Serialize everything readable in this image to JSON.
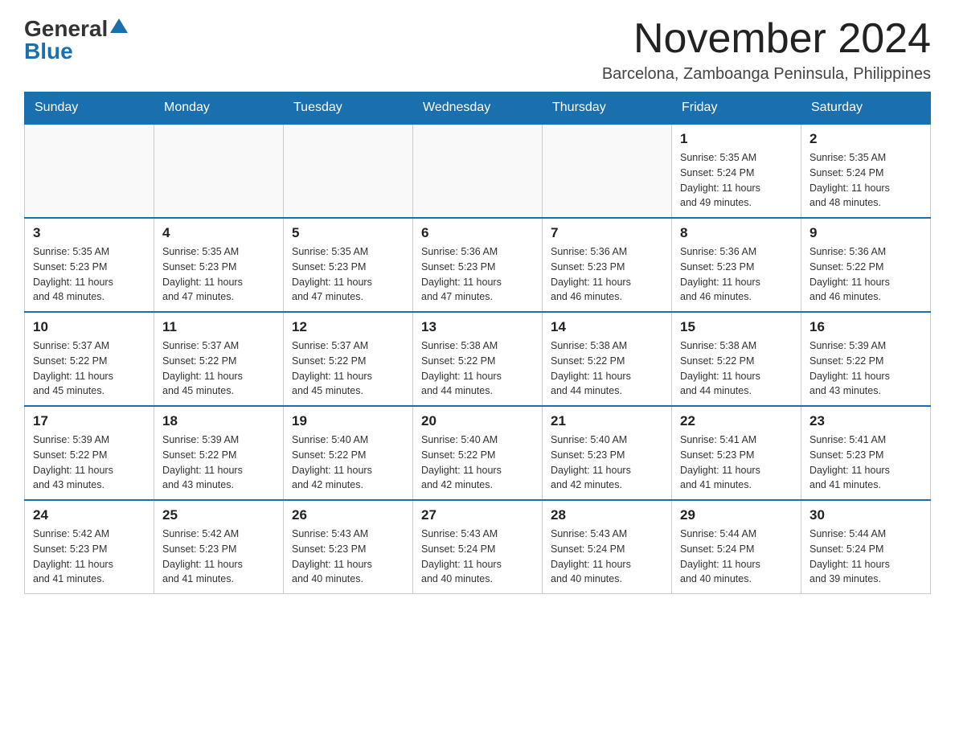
{
  "logo": {
    "text_general": "General",
    "text_blue": "Blue",
    "alt": "GeneralBlue Logo"
  },
  "title": "November 2024",
  "subtitle": "Barcelona, Zamboanga Peninsula, Philippines",
  "days_of_week": [
    "Sunday",
    "Monday",
    "Tuesday",
    "Wednesday",
    "Thursday",
    "Friday",
    "Saturday"
  ],
  "weeks": [
    [
      {
        "day": "",
        "info": ""
      },
      {
        "day": "",
        "info": ""
      },
      {
        "day": "",
        "info": ""
      },
      {
        "day": "",
        "info": ""
      },
      {
        "day": "",
        "info": ""
      },
      {
        "day": "1",
        "info": "Sunrise: 5:35 AM\nSunset: 5:24 PM\nDaylight: 11 hours\nand 49 minutes."
      },
      {
        "day": "2",
        "info": "Sunrise: 5:35 AM\nSunset: 5:24 PM\nDaylight: 11 hours\nand 48 minutes."
      }
    ],
    [
      {
        "day": "3",
        "info": "Sunrise: 5:35 AM\nSunset: 5:23 PM\nDaylight: 11 hours\nand 48 minutes."
      },
      {
        "day": "4",
        "info": "Sunrise: 5:35 AM\nSunset: 5:23 PM\nDaylight: 11 hours\nand 47 minutes."
      },
      {
        "day": "5",
        "info": "Sunrise: 5:35 AM\nSunset: 5:23 PM\nDaylight: 11 hours\nand 47 minutes."
      },
      {
        "day": "6",
        "info": "Sunrise: 5:36 AM\nSunset: 5:23 PM\nDaylight: 11 hours\nand 47 minutes."
      },
      {
        "day": "7",
        "info": "Sunrise: 5:36 AM\nSunset: 5:23 PM\nDaylight: 11 hours\nand 46 minutes."
      },
      {
        "day": "8",
        "info": "Sunrise: 5:36 AM\nSunset: 5:23 PM\nDaylight: 11 hours\nand 46 minutes."
      },
      {
        "day": "9",
        "info": "Sunrise: 5:36 AM\nSunset: 5:22 PM\nDaylight: 11 hours\nand 46 minutes."
      }
    ],
    [
      {
        "day": "10",
        "info": "Sunrise: 5:37 AM\nSunset: 5:22 PM\nDaylight: 11 hours\nand 45 minutes."
      },
      {
        "day": "11",
        "info": "Sunrise: 5:37 AM\nSunset: 5:22 PM\nDaylight: 11 hours\nand 45 minutes."
      },
      {
        "day": "12",
        "info": "Sunrise: 5:37 AM\nSunset: 5:22 PM\nDaylight: 11 hours\nand 45 minutes."
      },
      {
        "day": "13",
        "info": "Sunrise: 5:38 AM\nSunset: 5:22 PM\nDaylight: 11 hours\nand 44 minutes."
      },
      {
        "day": "14",
        "info": "Sunrise: 5:38 AM\nSunset: 5:22 PM\nDaylight: 11 hours\nand 44 minutes."
      },
      {
        "day": "15",
        "info": "Sunrise: 5:38 AM\nSunset: 5:22 PM\nDaylight: 11 hours\nand 44 minutes."
      },
      {
        "day": "16",
        "info": "Sunrise: 5:39 AM\nSunset: 5:22 PM\nDaylight: 11 hours\nand 43 minutes."
      }
    ],
    [
      {
        "day": "17",
        "info": "Sunrise: 5:39 AM\nSunset: 5:22 PM\nDaylight: 11 hours\nand 43 minutes."
      },
      {
        "day": "18",
        "info": "Sunrise: 5:39 AM\nSunset: 5:22 PM\nDaylight: 11 hours\nand 43 minutes."
      },
      {
        "day": "19",
        "info": "Sunrise: 5:40 AM\nSunset: 5:22 PM\nDaylight: 11 hours\nand 42 minutes."
      },
      {
        "day": "20",
        "info": "Sunrise: 5:40 AM\nSunset: 5:22 PM\nDaylight: 11 hours\nand 42 minutes."
      },
      {
        "day": "21",
        "info": "Sunrise: 5:40 AM\nSunset: 5:23 PM\nDaylight: 11 hours\nand 42 minutes."
      },
      {
        "day": "22",
        "info": "Sunrise: 5:41 AM\nSunset: 5:23 PM\nDaylight: 11 hours\nand 41 minutes."
      },
      {
        "day": "23",
        "info": "Sunrise: 5:41 AM\nSunset: 5:23 PM\nDaylight: 11 hours\nand 41 minutes."
      }
    ],
    [
      {
        "day": "24",
        "info": "Sunrise: 5:42 AM\nSunset: 5:23 PM\nDaylight: 11 hours\nand 41 minutes."
      },
      {
        "day": "25",
        "info": "Sunrise: 5:42 AM\nSunset: 5:23 PM\nDaylight: 11 hours\nand 41 minutes."
      },
      {
        "day": "26",
        "info": "Sunrise: 5:43 AM\nSunset: 5:23 PM\nDaylight: 11 hours\nand 40 minutes."
      },
      {
        "day": "27",
        "info": "Sunrise: 5:43 AM\nSunset: 5:24 PM\nDaylight: 11 hours\nand 40 minutes."
      },
      {
        "day": "28",
        "info": "Sunrise: 5:43 AM\nSunset: 5:24 PM\nDaylight: 11 hours\nand 40 minutes."
      },
      {
        "day": "29",
        "info": "Sunrise: 5:44 AM\nSunset: 5:24 PM\nDaylight: 11 hours\nand 40 minutes."
      },
      {
        "day": "30",
        "info": "Sunrise: 5:44 AM\nSunset: 5:24 PM\nDaylight: 11 hours\nand 39 minutes."
      }
    ]
  ]
}
